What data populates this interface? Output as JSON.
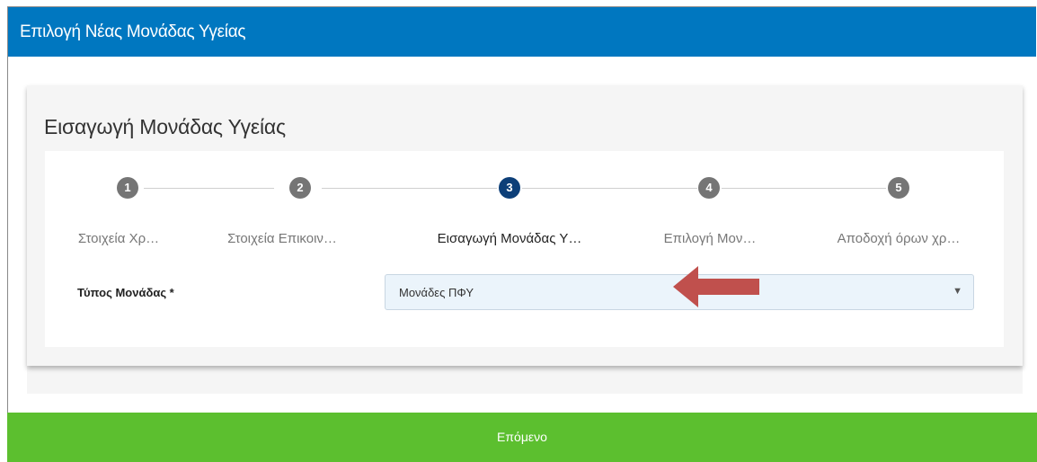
{
  "dialog": {
    "title": "Επιλογή Νέας Μονάδας Υγείας"
  },
  "card": {
    "title": "Εισαγωγή Μονάδας Υγείας"
  },
  "stepper": {
    "steps": [
      {
        "number": "1",
        "label": "Στοιχεία Χρ…",
        "active": false
      },
      {
        "number": "2",
        "label": "Στοιχεία Επικοιν…",
        "active": false
      },
      {
        "number": "3",
        "label": "Εισαγωγή Μονάδας Υ…",
        "active": true
      },
      {
        "number": "4",
        "label": "Επιλογή Μον…",
        "active": false
      },
      {
        "number": "5",
        "label": "Αποδοχή όρων χρ…",
        "active": false
      }
    ]
  },
  "form": {
    "unit_type_label": "Τύπος Μονάδας *",
    "unit_type_value": "Μονάδες ΠΦΥ"
  },
  "footer": {
    "next_label": "Επόμενο"
  },
  "colors": {
    "header": "#0077c0",
    "active_step": "#0d3f78",
    "inactive_step": "#757575",
    "next_button": "#5cbf2f",
    "annotation_arrow": "#c0504d"
  },
  "icons": {
    "dropdown": "chevron-down-icon",
    "annotation": "arrow-left-icon"
  }
}
